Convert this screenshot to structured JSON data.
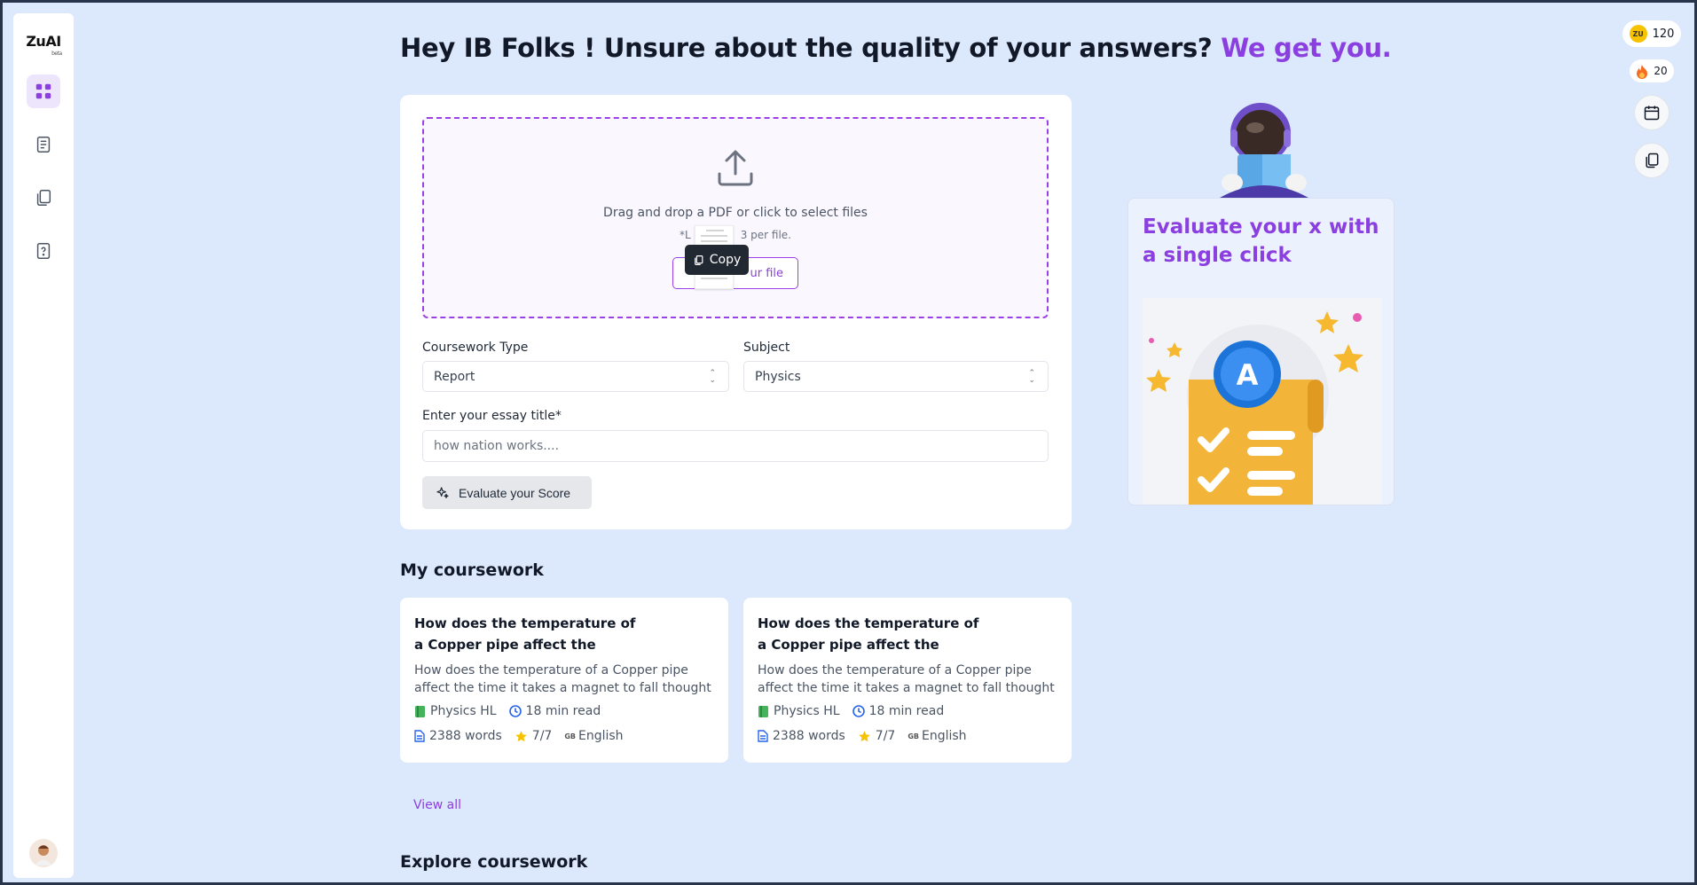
{
  "brand": {
    "name": "ZuAI",
    "badge": "beta"
  },
  "headline": {
    "main": "Hey IB Folks ! Unsure about the quality of your answers?",
    "accent": "We get you."
  },
  "upload": {
    "drop_text": "Drag and drop a PDF or click to select files",
    "limit_left": "*L",
    "limit_right": "3 per file.",
    "button_label": "ur file",
    "tooltip_label": "Copy"
  },
  "form": {
    "coursework_type_label": "Coursework Type",
    "coursework_type_value": "Report",
    "subject_label": "Subject",
    "subject_value": "Physics",
    "essay_title_label": "Enter your essay title*",
    "essay_title_placeholder": "how nation works....",
    "evaluate_label": "Evaluate your Score"
  },
  "promo": {
    "title": "Evaluate your x with a single click",
    "badge_letter": "A"
  },
  "my_coursework": {
    "title": "My coursework",
    "cards": [
      {
        "title": "How does the temperature of a Copper pipe affect the",
        "description": "How does the temperature of a Copper pipe affect the time it takes a magnet to fall thought",
        "subject": "Physics HL",
        "read_time": "18 min read",
        "words": "2388 words",
        "score": "7/7",
        "lang_code": "GB",
        "language": "English"
      },
      {
        "title": "How does the temperature of a Copper pipe affect the",
        "description": "How does the temperature of a Copper pipe affect the time it takes a magnet to fall thought",
        "subject": "Physics HL",
        "read_time": "18 min read",
        "words": "2388 words",
        "score": "7/7",
        "lang_code": "GB",
        "language": "English"
      }
    ],
    "view_all": "View all"
  },
  "explore": {
    "title": "Explore coursework"
  },
  "rail": {
    "coins": "120",
    "coin_label": "ZU",
    "streak": "20"
  },
  "colors": {
    "accent": "#8b3fe0",
    "background": "#dce8fb",
    "coin": "#f7c300",
    "streak": "#f36c21"
  }
}
